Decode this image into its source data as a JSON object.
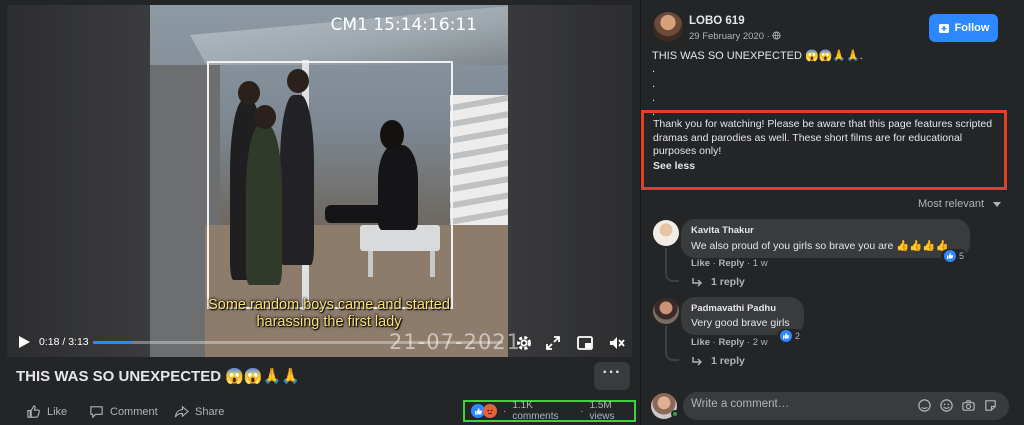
{
  "video": {
    "camera_stamp": "CM1 15:14:16:11",
    "date_stamp": "21-07-2021",
    "subtitle_line1": "Some random boys came and started",
    "subtitle_line2": "harassing the first lady",
    "time": "0:18 / 3:13",
    "progress_fraction": 0.094
  },
  "post": {
    "title": "THIS WAS SO UNEXPECTED 😱😱🙏🙏",
    "more_label": "···",
    "actions": {
      "like": "Like",
      "comment": "Comment",
      "share": "Share"
    },
    "stats": {
      "comments": "1.1K comments",
      "views": "1.5M views",
      "sep": "·"
    }
  },
  "panel": {
    "page_name": "LOBO 619",
    "post_date": "29 February 2020 · ",
    "follow_label": "Follow",
    "caption": "THIS WAS SO UNEXPECTED 😱😱🙏🙏.",
    "dots": [
      ".",
      ".",
      ".",
      "."
    ],
    "description": "Thank you for watching! Please be aware that this page features scripted dramas and parodies as well. These short films are for educational purposes only!",
    "see_less": "See less",
    "sort_label": "Most relevant",
    "comments": [
      {
        "name": "Kavita Thakur",
        "text": "We also proud of you girls so brave you are 👍👍👍👍",
        "like": "Like",
        "reply": "Reply",
        "age": "1 w",
        "reactions": "5",
        "replies": "1 reply"
      },
      {
        "name": "Padmavathi Padhu",
        "text": "Very good brave girls",
        "like": "Like",
        "reply": "Reply",
        "age": "2 w",
        "reactions": "2",
        "replies": "1 reply"
      }
    ],
    "composer_placeholder": "Write a comment…"
  },
  "colors": {
    "accent": "#2d88ff",
    "highlight_red": "#e2411f",
    "highlight_green": "#3ed33c"
  }
}
